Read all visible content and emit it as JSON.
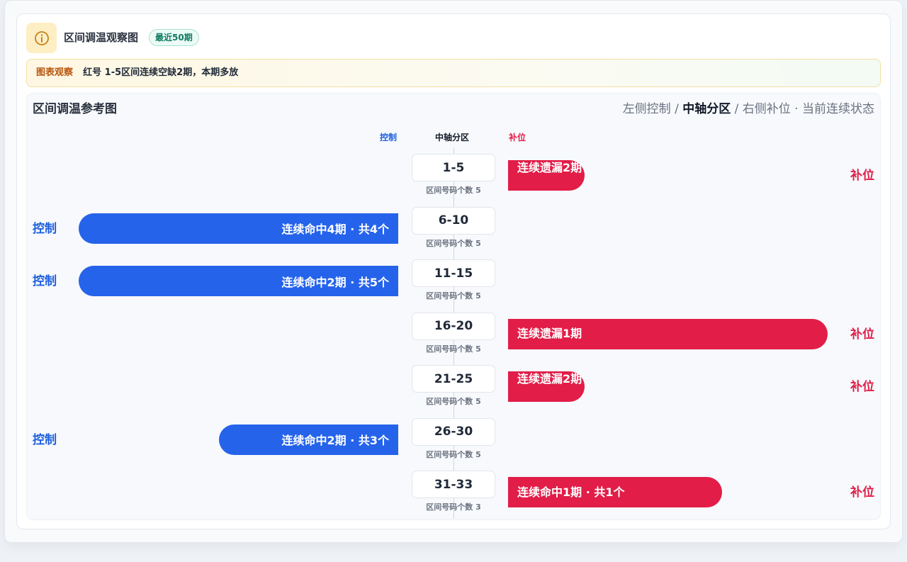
{
  "header": {
    "title": "区间调温观察图",
    "badge": "最近50期",
    "icon": "info-icon"
  },
  "notice": {
    "tag": "图表观察",
    "message": "红号 1-5区间连续空缺2期，本期多放"
  },
  "panel": {
    "title": "区间调温参考图",
    "legend": {
      "left": "左侧控制",
      "sep1": " / ",
      "center": "中轴分区",
      "sep2": " / ",
      "right": "右侧补位",
      "sep3": " · ",
      "state": "当前连续状态"
    },
    "columns": {
      "left": "控制",
      "center": "中轴分区",
      "right": "补位"
    }
  },
  "colors": {
    "control": "#2563eb",
    "fill": "#e11d48"
  },
  "zones": [
    {
      "range": "1-5",
      "count_label": "区间号码个数 5",
      "side": "right",
      "bar_text": "连续遗漏2期",
      "strength": 0.24,
      "side_label": "补位"
    },
    {
      "range": "6-10",
      "count_label": "区间号码个数 5",
      "side": "left",
      "bar_text": "连续命中4期 · 共4个",
      "strength": 1.0,
      "side_label": "控制"
    },
    {
      "range": "11-15",
      "count_label": "区间号码个数 5",
      "side": "left",
      "bar_text": "连续命中2期 · 共5个",
      "strength": 1.0,
      "side_label": "控制"
    },
    {
      "range": "16-20",
      "count_label": "区间号码个数 5",
      "side": "right",
      "bar_text": "连续遗漏1期",
      "strength": 1.0,
      "side_label": "补位"
    },
    {
      "range": "21-25",
      "count_label": "区间号码个数 5",
      "side": "right",
      "bar_text": "连续遗漏2期",
      "strength": 0.24,
      "side_label": "补位"
    },
    {
      "range": "26-30",
      "count_label": "区间号码个数 5",
      "side": "left",
      "bar_text": "连续命中2期 · 共3个",
      "strength": 0.56,
      "side_label": "控制"
    },
    {
      "range": "31-33",
      "count_label": "区间号码个数 3",
      "side": "right",
      "bar_text": "连续命中1期 · 共1个",
      "strength": 0.67,
      "side_label": "补位"
    }
  ]
}
